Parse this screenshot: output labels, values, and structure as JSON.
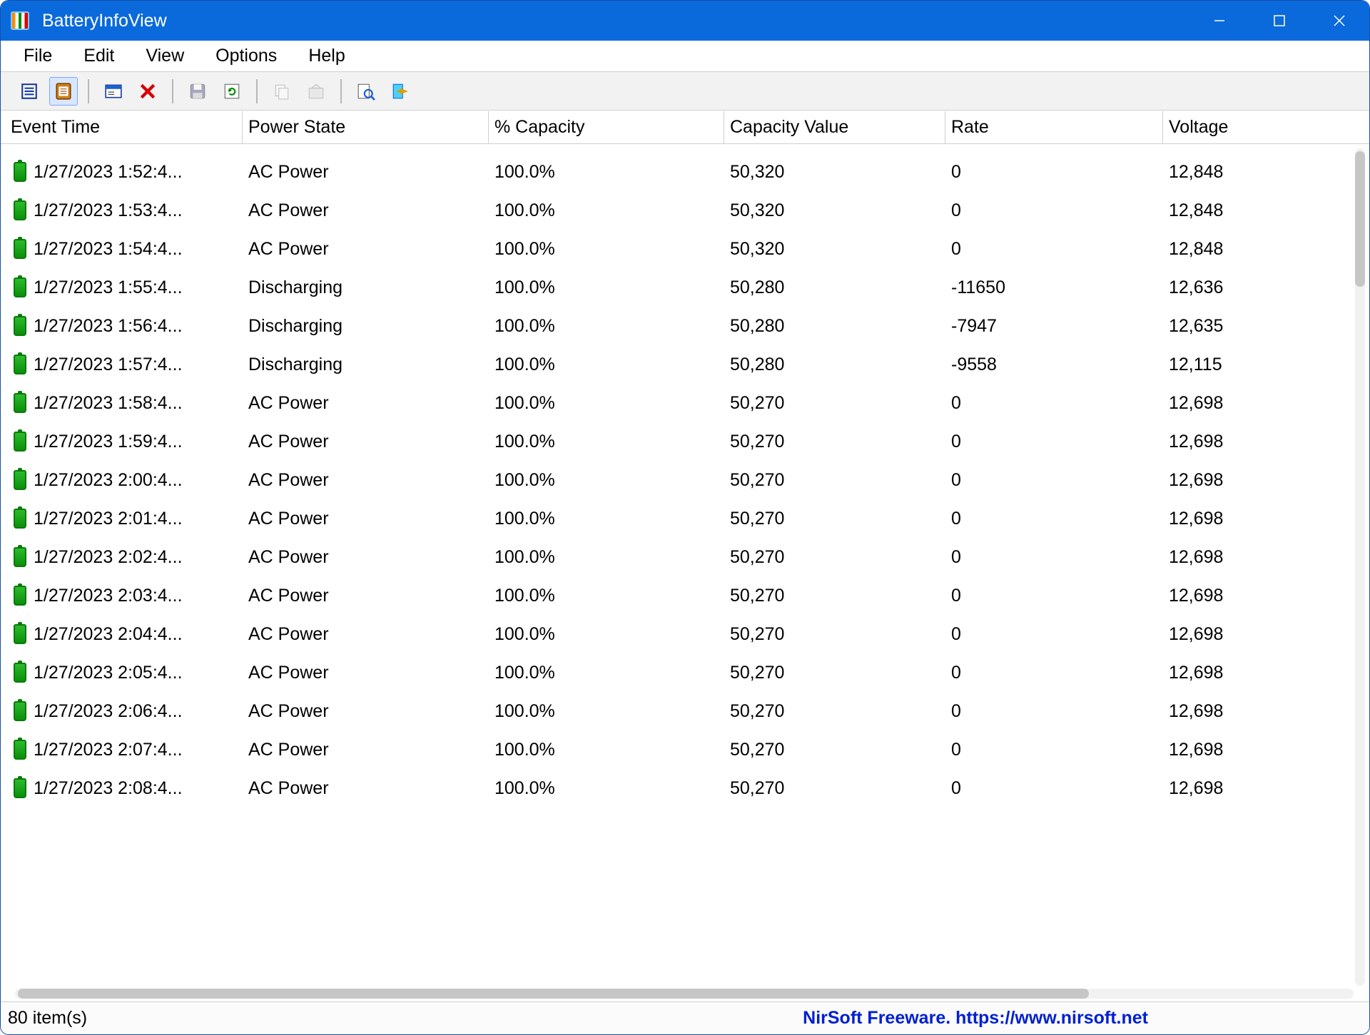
{
  "window": {
    "title": "BatteryInfoView"
  },
  "menubar": {
    "items": [
      "File",
      "Edit",
      "View",
      "Options",
      "Help"
    ]
  },
  "toolbar": {
    "buttons": [
      {
        "name": "view-info-icon",
        "tip": "Battery Information"
      },
      {
        "name": "view-log-icon",
        "tip": "Battery Log",
        "selected": true
      }
    ],
    "buttons2": [
      {
        "name": "properties-icon",
        "tip": "Properties"
      },
      {
        "name": "delete-icon",
        "tip": "Clear Log"
      }
    ],
    "buttons3": [
      {
        "name": "save-icon",
        "tip": "Save",
        "disabled": true
      },
      {
        "name": "refresh-icon",
        "tip": "Refresh"
      }
    ],
    "buttons4": [
      {
        "name": "copy-icon",
        "tip": "Copy",
        "disabled": true
      },
      {
        "name": "options-icon",
        "tip": "Options",
        "disabled": true
      }
    ],
    "buttons5": [
      {
        "name": "find-icon",
        "tip": "Find"
      },
      {
        "name": "exit-icon",
        "tip": "Exit"
      }
    ]
  },
  "columns": [
    "Event Time",
    "Power State",
    "% Capacity",
    "Capacity Value",
    "Rate",
    "Voltage"
  ],
  "rows": [
    {
      "time": "1/27/2023 1:52:4...",
      "state": "AC Power",
      "pct": "100.0%",
      "cap": "50,320",
      "rate": "0",
      "volt": "12,848"
    },
    {
      "time": "1/27/2023 1:53:4...",
      "state": "AC Power",
      "pct": "100.0%",
      "cap": "50,320",
      "rate": "0",
      "volt": "12,848"
    },
    {
      "time": "1/27/2023 1:54:4...",
      "state": "AC Power",
      "pct": "100.0%",
      "cap": "50,320",
      "rate": "0",
      "volt": "12,848"
    },
    {
      "time": "1/27/2023 1:55:4...",
      "state": "Discharging",
      "pct": "100.0%",
      "cap": "50,280",
      "rate": "-11650",
      "volt": "12,636"
    },
    {
      "time": "1/27/2023 1:56:4...",
      "state": "Discharging",
      "pct": "100.0%",
      "cap": "50,280",
      "rate": "-7947",
      "volt": "12,635"
    },
    {
      "time": "1/27/2023 1:57:4...",
      "state": "Discharging",
      "pct": "100.0%",
      "cap": "50,280",
      "rate": "-9558",
      "volt": "12,115"
    },
    {
      "time": "1/27/2023 1:58:4...",
      "state": "AC Power",
      "pct": "100.0%",
      "cap": "50,270",
      "rate": "0",
      "volt": "12,698"
    },
    {
      "time": "1/27/2023 1:59:4...",
      "state": "AC Power",
      "pct": "100.0%",
      "cap": "50,270",
      "rate": "0",
      "volt": "12,698"
    },
    {
      "time": "1/27/2023 2:00:4...",
      "state": "AC Power",
      "pct": "100.0%",
      "cap": "50,270",
      "rate": "0",
      "volt": "12,698"
    },
    {
      "time": "1/27/2023 2:01:4...",
      "state": "AC Power",
      "pct": "100.0%",
      "cap": "50,270",
      "rate": "0",
      "volt": "12,698"
    },
    {
      "time": "1/27/2023 2:02:4...",
      "state": "AC Power",
      "pct": "100.0%",
      "cap": "50,270",
      "rate": "0",
      "volt": "12,698"
    },
    {
      "time": "1/27/2023 2:03:4...",
      "state": "AC Power",
      "pct": "100.0%",
      "cap": "50,270",
      "rate": "0",
      "volt": "12,698"
    },
    {
      "time": "1/27/2023 2:04:4...",
      "state": "AC Power",
      "pct": "100.0%",
      "cap": "50,270",
      "rate": "0",
      "volt": "12,698"
    },
    {
      "time": "1/27/2023 2:05:4...",
      "state": "AC Power",
      "pct": "100.0%",
      "cap": "50,270",
      "rate": "0",
      "volt": "12,698"
    },
    {
      "time": "1/27/2023 2:06:4...",
      "state": "AC Power",
      "pct": "100.0%",
      "cap": "50,270",
      "rate": "0",
      "volt": "12,698"
    },
    {
      "time": "1/27/2023 2:07:4...",
      "state": "AC Power",
      "pct": "100.0%",
      "cap": "50,270",
      "rate": "0",
      "volt": "12,698"
    },
    {
      "time": "1/27/2023 2:08:4...",
      "state": "AC Power",
      "pct": "100.0%",
      "cap": "50,270",
      "rate": "0",
      "volt": "12,698"
    }
  ],
  "status": {
    "count": "80 item(s)",
    "link": "NirSoft Freeware. https://www.nirsoft.net"
  }
}
